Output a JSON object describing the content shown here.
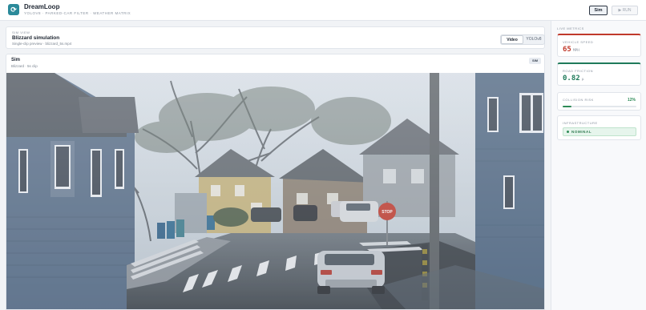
{
  "app": {
    "logo_glyph": "⟳",
    "title": "DreamLoop",
    "subtitle": "YOLOV8 · PARKED-CAR FILTER · WEATHER MATRIX"
  },
  "header": {
    "sim_label": "Sim",
    "run_label": "▶ RUN"
  },
  "sim_view": {
    "section_label": "SIM VIEW",
    "title": "Blizzard simulation",
    "subtitle": "Single-clip preview · blizzard_5s.mp4",
    "tabs": [
      {
        "label": "Video",
        "active": true
      },
      {
        "label": "YOLOv8",
        "active": false
      }
    ]
  },
  "sim_card": {
    "title": "Sim",
    "subtitle": "Blizzard · 5s clip",
    "badge": "SIM"
  },
  "live_metrics": {
    "section_label": "LIVE METRICS",
    "vehicle_speed": {
      "label": "VEHICLE SPEED",
      "value": "65",
      "unit": "MPH",
      "color": "#c0392b"
    },
    "road_friction": {
      "label": "ROAD FRICTION",
      "value": "0.82",
      "unit": "μ",
      "color": "#1f7a5a"
    },
    "collision_risk": {
      "label": "COLLISION RISK",
      "value": "12%",
      "fraction": 0.12,
      "color": "#2e8b57"
    },
    "infrastructure": {
      "label": "INFRASTRUCTURE",
      "status": "NOMINAL"
    }
  }
}
